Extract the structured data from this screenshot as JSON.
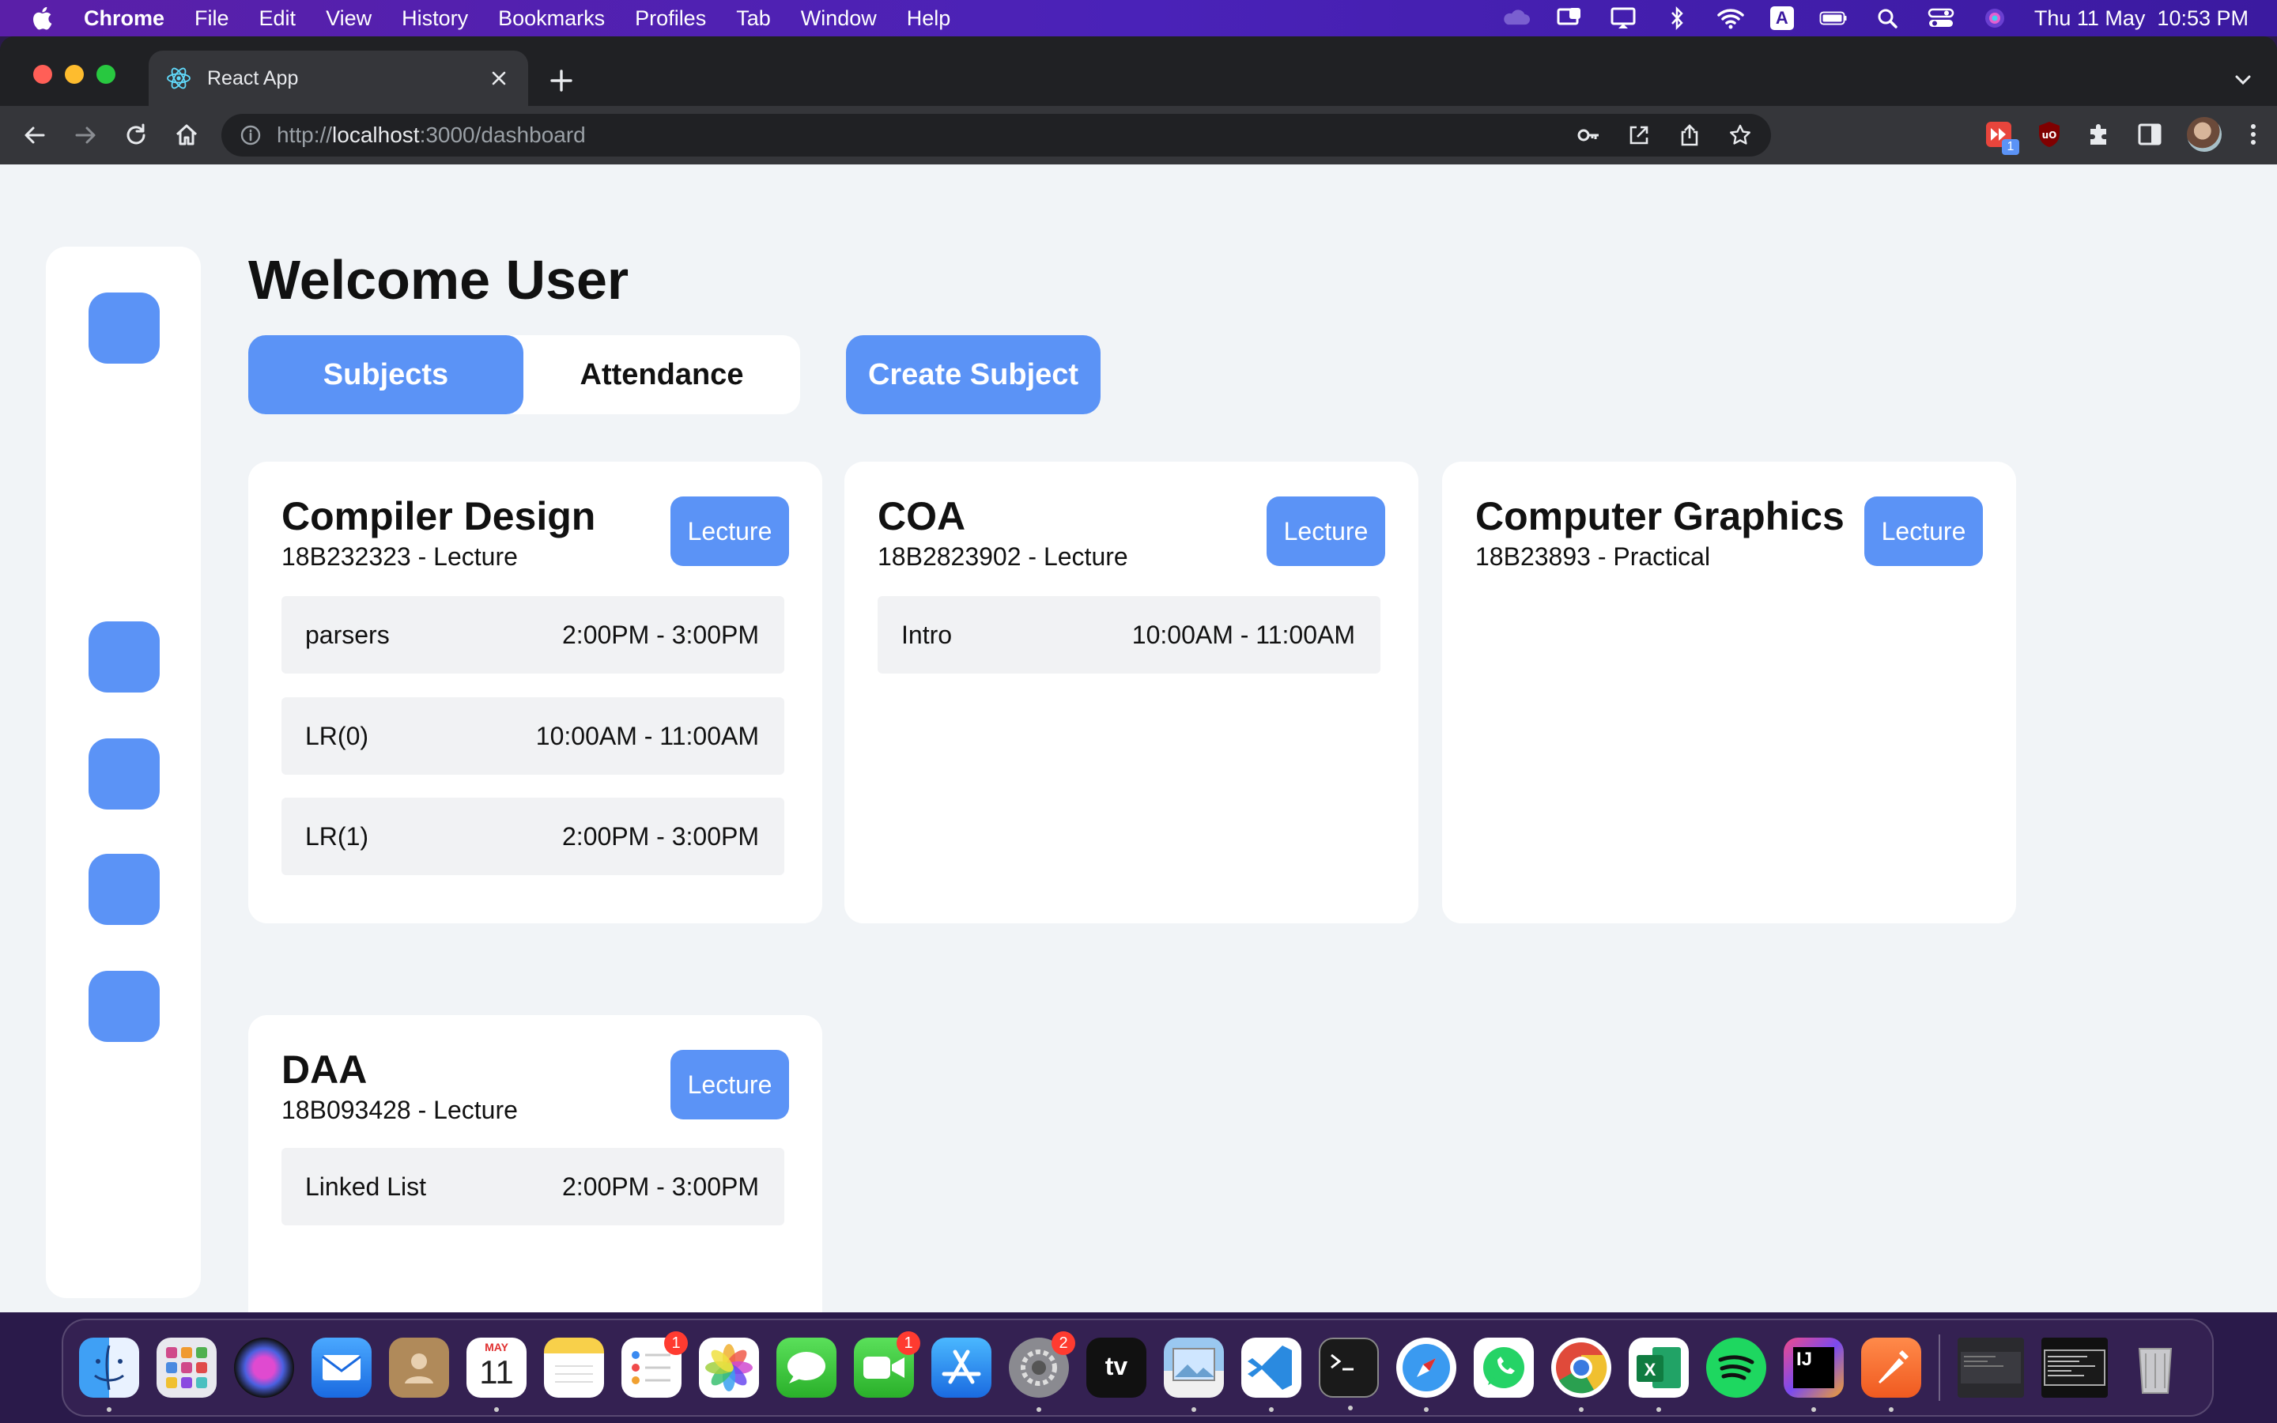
{
  "menubar": {
    "app": "Chrome",
    "items": [
      "File",
      "Edit",
      "View",
      "History",
      "Bookmarks",
      "Profiles",
      "Tab",
      "Window",
      "Help"
    ],
    "clock": "Thu 11 May  10:53 PM",
    "input_source": "A"
  },
  "browser": {
    "tab_title": "React App",
    "url_scheme": "http://",
    "url_host": "localhost",
    "url_rest": ":3000/dashboard",
    "extension_badge": "1"
  },
  "page": {
    "welcome": "Welcome User",
    "tabs": {
      "subjects": "Subjects",
      "attendance": "Attendance"
    },
    "create_subject": "Create Subject",
    "cards": [
      {
        "title": "Compiler Design",
        "code": "18B232323 - Lecture",
        "badge": "Lecture",
        "sessions": [
          {
            "name": "parsers",
            "time": "2:00PM - 3:00PM"
          },
          {
            "name": "LR(0)",
            "time": "10:00AM - 11:00AM"
          },
          {
            "name": "LR(1)",
            "time": "2:00PM - 3:00PM"
          }
        ]
      },
      {
        "title": "COA",
        "code": "18B2823902 - Lecture",
        "badge": "Lecture",
        "sessions": [
          {
            "name": "Intro",
            "time": "10:00AM - 11:00AM"
          }
        ]
      },
      {
        "title": "Computer Graphics",
        "code": "18B23893 - Practical",
        "badge": "Lecture",
        "sessions": []
      },
      {
        "title": "DAA",
        "code": "18B093428 - Lecture",
        "badge": "Lecture",
        "sessions": [
          {
            "name": "Linked List",
            "time": "2:00PM - 3:00PM"
          }
        ]
      }
    ]
  },
  "dock": {
    "calendar_month": "MAY",
    "calendar_day": "11",
    "reminders_badge": "1",
    "facetime_badge": "1",
    "settings_badge": "2",
    "tv_label": "tv",
    "intellij_label": "IJ",
    "excel_label": "X"
  },
  "colors": {
    "accent": "#5b93f6",
    "page_bg": "#f1f4f7",
    "card_bg": "#ffffff"
  }
}
